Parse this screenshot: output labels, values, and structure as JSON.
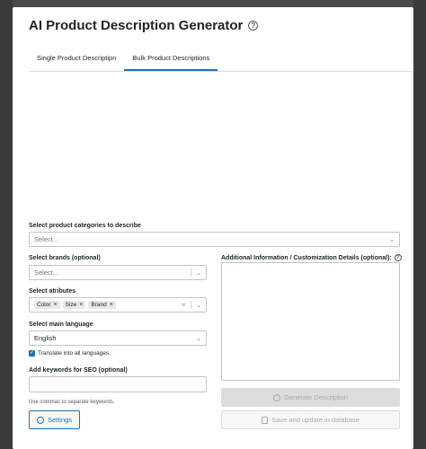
{
  "modal": {
    "title": "AI Product Description Generator",
    "help_icon": "?"
  },
  "tabs": [
    {
      "label": "Single Product Descriptipn",
      "active": false
    },
    {
      "label": "Bulk Product Descriptions",
      "active": true
    }
  ],
  "categories": {
    "label": "Select product categories to describe",
    "placeholder": "Select..."
  },
  "brands": {
    "label": "Select brands (optional)",
    "placeholder": "Select..."
  },
  "attributes": {
    "label": "Select atributes",
    "chips": [
      "Color",
      "Size",
      "Brand"
    ],
    "chip_remove": "×",
    "clear": "×"
  },
  "language": {
    "label": "Select main language",
    "value": "English"
  },
  "translate": {
    "checked": true,
    "label": "Translate into all languages."
  },
  "keywords": {
    "label": "Add keywords for SEO (optional)",
    "value": "",
    "hint": "Use commas to separate keywords."
  },
  "additional": {
    "label": "Additional Information / Customization Details  (optional):",
    "value": ""
  },
  "buttons": {
    "settings": "Settings",
    "generate": "Generate Description",
    "save": "Save and update in database"
  },
  "colors": {
    "accent": "#2271b1",
    "disabled_bg": "#dcdcde",
    "disabled_text": "#a7aaad"
  }
}
